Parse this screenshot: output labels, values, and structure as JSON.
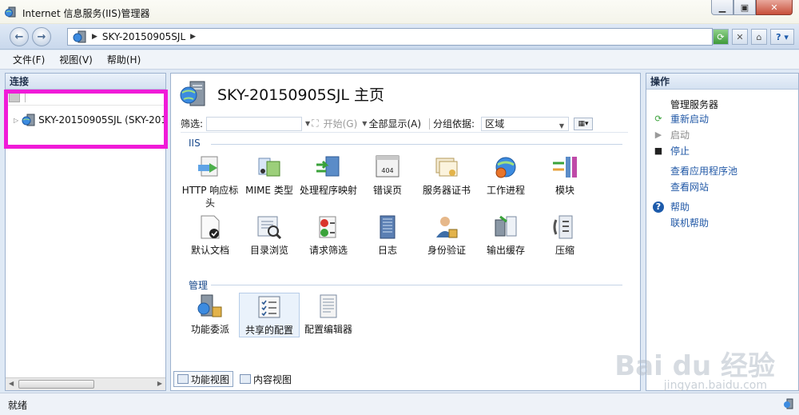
{
  "window": {
    "title": "Internet 信息服务(IIS)管理器"
  },
  "address": {
    "server": "SKY-20150905SJL"
  },
  "menu": [
    "文件(F)",
    "视图(V)",
    "帮助(H)"
  ],
  "connections": {
    "header": "连接",
    "node_label": "SKY-20150905SJL (SKY-201"
  },
  "home": {
    "title": "SKY-20150905SJL 主页",
    "filter_label": "筛选:",
    "start_label": "开始(G)",
    "show_all_label": "全部显示(A)",
    "group_by_label": "分组依据:",
    "group_by_value": "区域"
  },
  "sections": {
    "iis": "IIS",
    "manage": "管理"
  },
  "features_iis": [
    {
      "label": "HTTP 响应标头",
      "icon": "http-response-headers-icon"
    },
    {
      "label": "MIME 类型",
      "icon": "mime-types-icon"
    },
    {
      "label": "处理程序映射",
      "icon": "handler-mappings-icon"
    },
    {
      "label": "错误页",
      "icon": "error-pages-icon"
    },
    {
      "label": "服务器证书",
      "icon": "server-certificates-icon"
    },
    {
      "label": "工作进程",
      "icon": "worker-processes-icon"
    },
    {
      "label": "模块",
      "icon": "modules-icon"
    },
    {
      "label": "默认文档",
      "icon": "default-document-icon"
    },
    {
      "label": "目录浏览",
      "icon": "directory-browsing-icon"
    },
    {
      "label": "请求筛选",
      "icon": "request-filtering-icon"
    },
    {
      "label": "日志",
      "icon": "logging-icon"
    },
    {
      "label": "身份验证",
      "icon": "authentication-icon"
    },
    {
      "label": "输出缓存",
      "icon": "output-caching-icon"
    },
    {
      "label": "压缩",
      "icon": "compression-icon"
    }
  ],
  "features_manage": [
    {
      "label": "功能委派",
      "icon": "feature-delegation-icon"
    },
    {
      "label": "共享的配置",
      "icon": "shared-configuration-icon"
    },
    {
      "label": "配置编辑器",
      "icon": "configuration-editor-icon"
    }
  ],
  "bottom_tabs": {
    "features_view": "功能视图",
    "content_view": "内容视图"
  },
  "actions": {
    "header": "操作",
    "group_title": "管理服务器",
    "restart": "重新启动",
    "start": "启动",
    "stop": "停止",
    "view_app_pools": "查看应用程序池",
    "view_sites": "查看网站",
    "help": "帮助",
    "online_help": "联机帮助"
  },
  "status": {
    "text": "就绪"
  },
  "watermark": {
    "brand": "Bai du 经验",
    "url": "jingyan.baidu.com"
  },
  "colors": {
    "highlight": "#f01bd8",
    "link": "#2158a6",
    "section": "#1a4a8c"
  }
}
